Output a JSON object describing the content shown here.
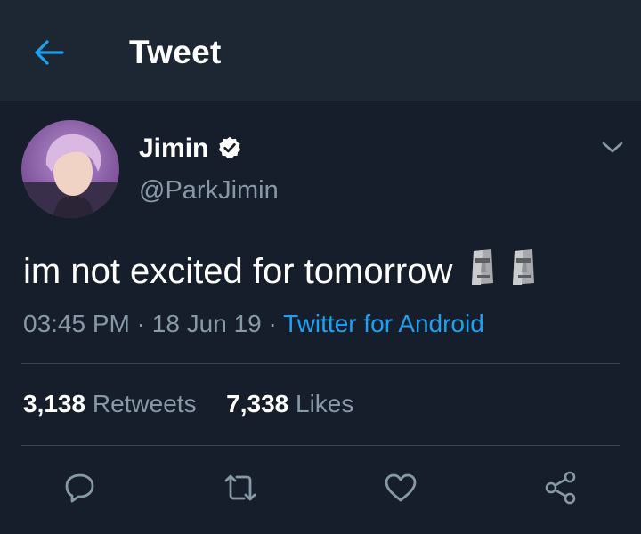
{
  "header": {
    "title": "Tweet",
    "back_icon": "arrow-left-icon"
  },
  "colors": {
    "background": "#151e2a",
    "header_bg": "#1c2733",
    "accent": "#1da1f2",
    "secondary_text": "#8899a6",
    "divider": "#38444d"
  },
  "tweet": {
    "display_name": "Jimin",
    "verified": true,
    "handle": "@ParkJimin",
    "text": "im not excited for tomorrow",
    "emoji": "moai-icon",
    "time": "03:45 PM",
    "sep1": " · ",
    "date": "18 Jun 19",
    "sep2": " · ",
    "source": "Twitter for Android"
  },
  "stats": {
    "retweets_count": "3,138",
    "retweets_label": "Retweets",
    "likes_count": "7,338",
    "likes_label": "Likes"
  },
  "actions": [
    "reply-icon",
    "retweet-icon",
    "like-icon",
    "share-icon"
  ]
}
